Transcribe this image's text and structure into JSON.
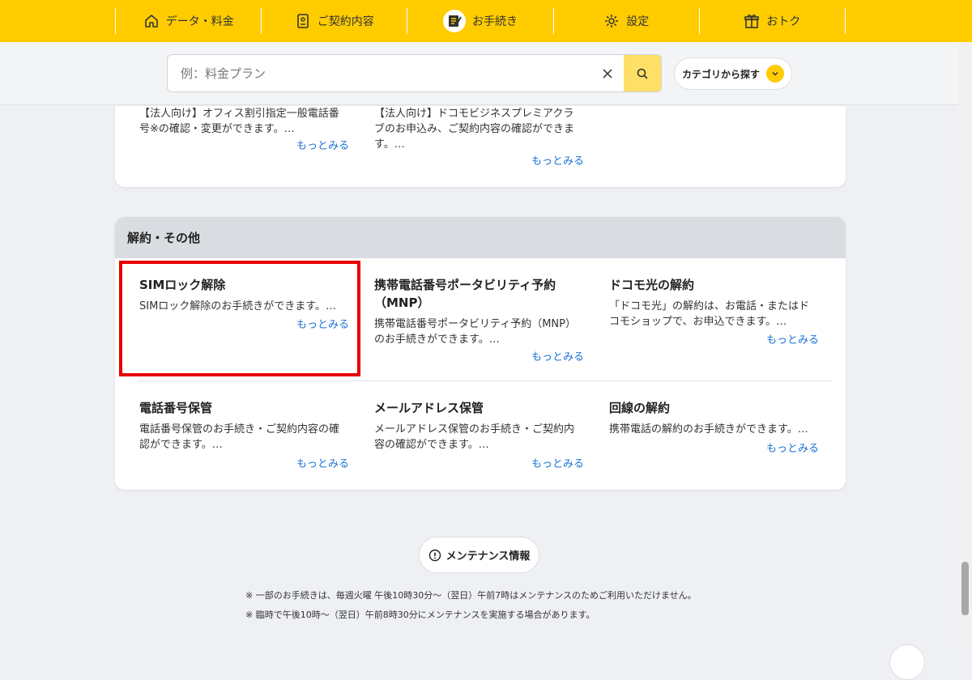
{
  "nav": {
    "items": [
      {
        "label": "データ・料金",
        "icon": "home-icon"
      },
      {
        "label": "ご契約内容",
        "icon": "contract-icon"
      },
      {
        "label": "お手続き",
        "icon": "procedure-icon"
      },
      {
        "label": "設定",
        "icon": "settings-icon"
      },
      {
        "label": "おトク",
        "icon": "gift-icon"
      }
    ],
    "active": "お手続き"
  },
  "search": {
    "placeholder": "例：料金プラン",
    "category_label": "カテゴリから探す"
  },
  "top_card": {
    "tiles": [
      {
        "desc_line1": "【法人向け】オフィス割引指定一般電話番",
        "desc_line2": "号※の確認・変更ができます。…",
        "more": "もっとみる"
      },
      {
        "desc_line1": "【法人向け】ドコモビジネスプレミアクラ",
        "desc_line2": "ブのお申込み、ご契約内容の確認ができま",
        "desc_line3": "す。…",
        "more": "もっとみる"
      }
    ]
  },
  "section": {
    "title": "解約・その他",
    "tiles": [
      {
        "title": "SIMロック解除",
        "desc_line1": "SIMロック解除のお手続きができます。…",
        "more": "もっとみる"
      },
      {
        "title": "携帯電話番号ポータビリティ予約",
        "title_line2": "（MNP）",
        "desc_line1": "携帯電話番号ポータビリティ予約（MNP）",
        "desc_line2": "のお手続きができます。…",
        "more": "もっとみる"
      },
      {
        "title": "ドコモ光の解約",
        "desc_line1": "「ドコモ光」の解約は、お電話・またはド",
        "desc_line2": "コモショップで、お申込できます。…",
        "more": "もっとみる"
      },
      {
        "title": "電話番号保管",
        "desc_line1": "電話番号保管のお手続き・ご契約内容の確",
        "desc_line2": "認ができます。…",
        "more": "もっとみる"
      },
      {
        "title": "メールアドレス保管",
        "desc_line1": "メールアドレス保管のお手続き・ご契約内",
        "desc_line2": "容の確認ができます。…",
        "more": "もっとみる"
      },
      {
        "title": "回線の解約",
        "desc_line1": "携帯電話の解約のお手続きができます。…",
        "more": "もっとみる"
      }
    ]
  },
  "maintenance": {
    "button_label": "メンテナンス情報",
    "notes": [
      "※ 一部のお手続きは、毎週火曜 午後10時30分～（翌日）午前7時はメンテナンスのためご利用いただけません。",
      "※ 臨時で午後10時～（翌日）午前8時30分にメンテナンスを実施する場合があります。"
    ]
  },
  "colors": {
    "brand_yellow": "#ffcc00",
    "link_blue": "#1a73d9",
    "highlight_red": "#e60000"
  }
}
